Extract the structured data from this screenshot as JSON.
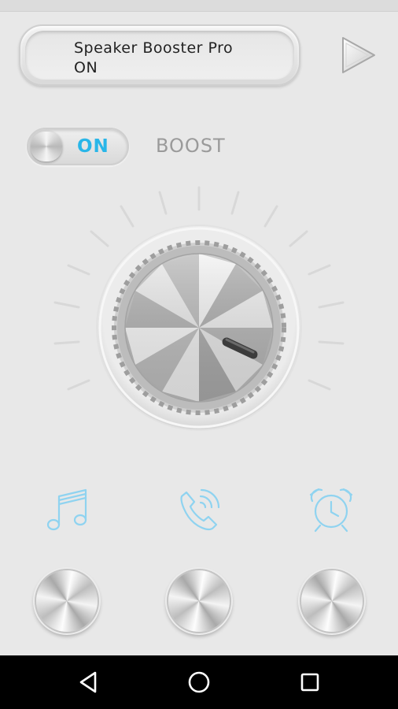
{
  "display": {
    "title": "Speaker Booster Pro",
    "status": "ON"
  },
  "boost_switch": {
    "state_label": "ON"
  },
  "boost": {
    "label": "BOOST"
  },
  "controls": {
    "music": {
      "icon": "music-note-icon"
    },
    "call": {
      "icon": "phone-call-icon"
    },
    "alarm": {
      "icon": "alarm-clock-icon"
    }
  },
  "icons": {
    "play": "play-icon",
    "nav_back": "back-triangle-icon",
    "nav_home": "home-circle-icon",
    "nav_recents": "recents-square-icon"
  },
  "colors": {
    "accent": "#29b6e8",
    "label_gray": "#9a9a9a",
    "background": "#e8e8e8",
    "navbar": "#000000"
  }
}
